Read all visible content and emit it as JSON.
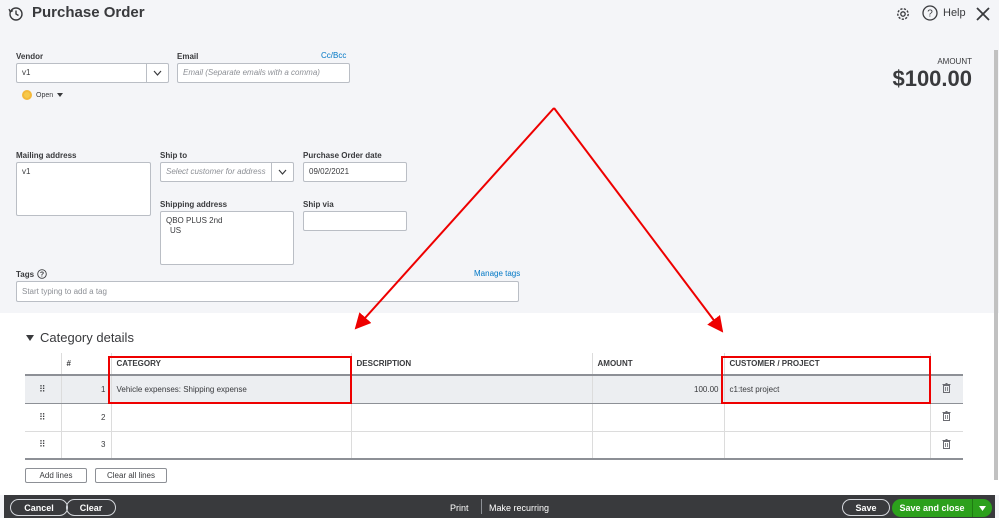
{
  "header": {
    "title": "Purchase Order",
    "help_label": "Help"
  },
  "form": {
    "vendor_label": "Vendor",
    "vendor_value": "v1",
    "email_label": "Email",
    "email_placeholder": "Email (Separate emails with a comma)",
    "ccbcc_link": "Cc/Bcc",
    "status_label": "Open",
    "amount_label": "AMOUNT",
    "amount_value": "$100.00",
    "mailing_address_label": "Mailing address",
    "mailing_address_value": "v1",
    "ship_to_label": "Ship to",
    "ship_to_placeholder": "Select customer for address",
    "po_date_label": "Purchase Order date",
    "po_date_value": "09/02/2021",
    "shipping_address_label": "Shipping address",
    "shipping_address_line1": "QBO PLUS 2nd",
    "shipping_address_line2": "US",
    "ship_via_label": "Ship via",
    "tags_label": "Tags",
    "tags_placeholder": "Start typing to add a tag",
    "manage_tags_link": "Manage tags"
  },
  "category_details": {
    "title": "Category details",
    "columns": [
      "#",
      "CATEGORY",
      "DESCRIPTION",
      "AMOUNT",
      "CUSTOMER / PROJECT"
    ],
    "rows": [
      {
        "num": "1",
        "category": "Vehicle expenses: Shipping expense",
        "description": "",
        "amount": "100.00",
        "customer": "c1:test project"
      },
      {
        "num": "2",
        "category": "",
        "description": "",
        "amount": "",
        "customer": ""
      },
      {
        "num": "3",
        "category": "",
        "description": "",
        "amount": "",
        "customer": ""
      }
    ],
    "add_lines_label": "Add lines",
    "clear_all_lines_label": "Clear all lines"
  },
  "footer": {
    "cancel_label": "Cancel",
    "clear_label": "Clear",
    "print_label": "Print",
    "make_recurring_label": "Make recurring",
    "save_label": "Save",
    "save_and_close_label": "Save and close"
  },
  "colors": {
    "primary_green": "#2ca01c",
    "link_blue": "#0077c5",
    "footer_dark": "#393a3d",
    "annotation_red": "#e00000",
    "status_yellow": "#f7c94a"
  },
  "icons": [
    "history-icon",
    "gear-icon",
    "help-icon",
    "close-icon",
    "chevron-down-icon",
    "drag-handle-icon",
    "trash-icon",
    "caret-down-icon"
  ]
}
